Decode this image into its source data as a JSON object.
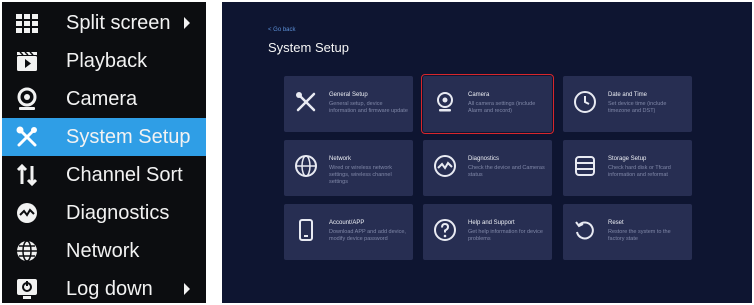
{
  "menu": {
    "items": [
      {
        "label": "Split screen",
        "icon": "grid-icon",
        "has_submenu": true
      },
      {
        "label": "Playback",
        "icon": "clapperboard-icon",
        "has_submenu": false
      },
      {
        "label": "Camera",
        "icon": "camera-icon",
        "has_submenu": false
      },
      {
        "label": "System Setup",
        "icon": "tools-icon",
        "has_submenu": false,
        "active": true
      },
      {
        "label": "Channel Sort",
        "icon": "sort-icon",
        "has_submenu": false
      },
      {
        "label": "Diagnostics",
        "icon": "diagnostics-icon",
        "has_submenu": false
      },
      {
        "label": "Network",
        "icon": "globe-icon",
        "has_submenu": false
      },
      {
        "label": "Log down",
        "icon": "logout-icon",
        "has_submenu": true
      }
    ],
    "active_color": "#2f9ee6"
  },
  "setup": {
    "back_label": "< Go back",
    "title": "System Setup",
    "tiles": [
      {
        "title": "General Setup",
        "desc": "General setup, device information and firmware update",
        "icon": "tools-icon"
      },
      {
        "title": "Camera",
        "desc": "All camera settings (include Alarm and record)",
        "icon": "camera-icon",
        "selected": true
      },
      {
        "title": "Date and Time",
        "desc": "Set device time (include timezone and DST)",
        "icon": "clock-icon"
      },
      {
        "title": "Network",
        "desc": "Wired or wireless network settings, wireless channel settings",
        "icon": "globe-icon"
      },
      {
        "title": "Diagnostics",
        "desc": "Check the device and Cameras status",
        "icon": "diagnostics-icon"
      },
      {
        "title": "Storage Setup",
        "desc": "Check hard disk or Tfcard information and reformat",
        "icon": "storage-icon"
      },
      {
        "title": "Account/APP",
        "desc": "Download APP and add device, modify device password",
        "icon": "phone-icon"
      },
      {
        "title": "Help and Support",
        "desc": "Get help information for device problems",
        "icon": "help-icon"
      },
      {
        "title": "Reset",
        "desc": "Restore the system to the factory state",
        "icon": "reset-icon"
      }
    ],
    "highlight_color": "#d7262c"
  }
}
